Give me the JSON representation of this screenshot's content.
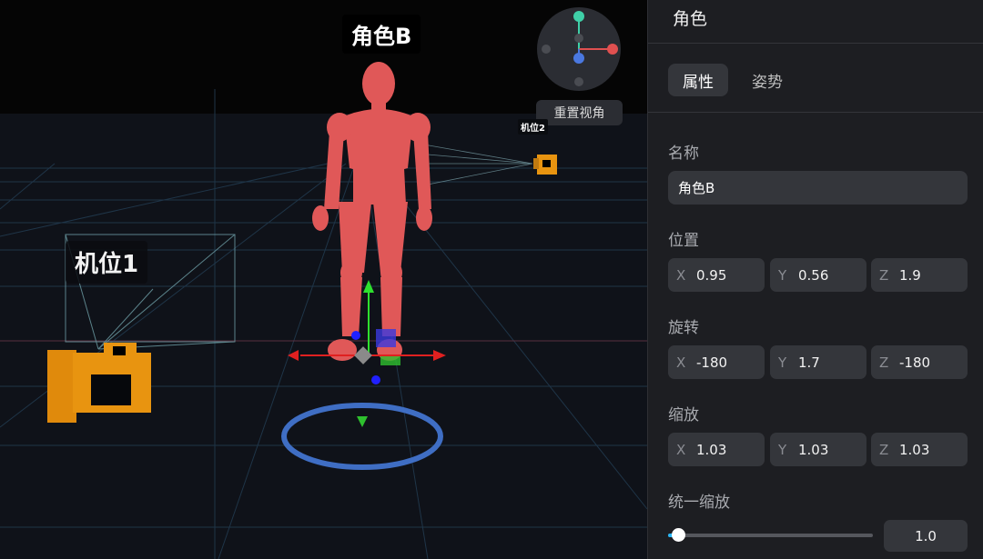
{
  "viewport": {
    "character_label": "角色B",
    "camera1_label": "机位1",
    "camera2_label": "机位2",
    "reset_view_label": "重置视角",
    "colors": {
      "character": "#e05858",
      "camera": "#e89410",
      "selection_ring": "#3f6ec4",
      "grid": "#1f3548"
    }
  },
  "panel": {
    "title": "角色",
    "tabs": [
      {
        "label": "属性",
        "active": true
      },
      {
        "label": "姿势",
        "active": false
      }
    ],
    "name": {
      "label": "名称",
      "value": "角色B"
    },
    "position": {
      "label": "位置",
      "x": "0.95",
      "y": "0.56",
      "z": "1.9"
    },
    "rotation": {
      "label": "旋转",
      "x": "-180",
      "y": "1.7",
      "z": "-180"
    },
    "scale": {
      "label": "缩放",
      "x": "1.03",
      "y": "1.03",
      "z": "1.03"
    },
    "uniform_scale": {
      "label": "统一缩放",
      "value": "1.0",
      "slider_fraction": 0.05
    },
    "axis_labels": {
      "x": "X",
      "y": "Y",
      "z": "Z"
    }
  }
}
